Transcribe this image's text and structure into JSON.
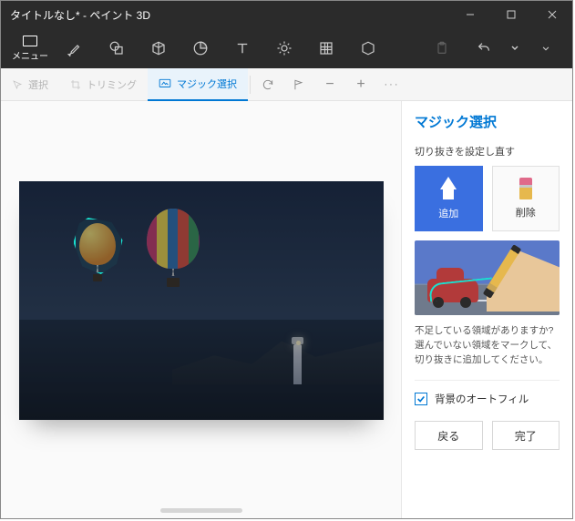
{
  "window": {
    "title": "タイトルなし* - ペイント 3D"
  },
  "menu": {
    "label": "メニュー"
  },
  "ribbon_tools": [
    "brushes-icon",
    "shapes-2d-icon",
    "shapes-3d-icon",
    "stickers-icon",
    "text-icon",
    "effects-icon",
    "canvas-icon",
    "library-3d-icon"
  ],
  "subtoolbar": {
    "select": "選択",
    "crop": "トリミング",
    "magic_select": "マジック選択"
  },
  "panel": {
    "title": "マジック選択",
    "subtitle": "切り抜きを設定し直す",
    "add": "追加",
    "remove": "削除",
    "hint": "不足している領域がありますか? 選んでいない領域をマークして、切り抜きに追加してください。",
    "autofill": "背景のオートフィル",
    "back": "戻る",
    "done": "完了"
  }
}
